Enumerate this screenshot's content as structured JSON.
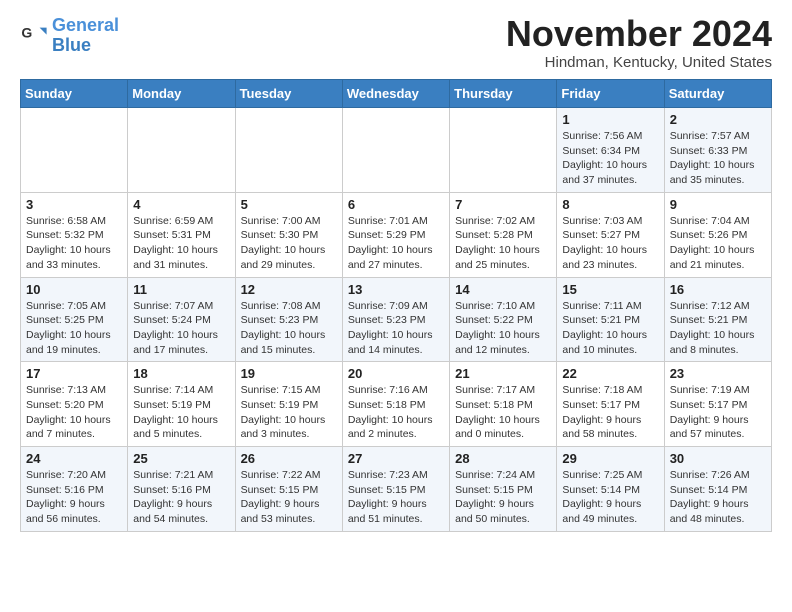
{
  "logo": {
    "line1": "General",
    "line2": "Blue"
  },
  "title": "November 2024",
  "location": "Hindman, Kentucky, United States",
  "weekdays": [
    "Sunday",
    "Monday",
    "Tuesday",
    "Wednesday",
    "Thursday",
    "Friday",
    "Saturday"
  ],
  "weeks": [
    [
      {
        "day": "",
        "info": ""
      },
      {
        "day": "",
        "info": ""
      },
      {
        "day": "",
        "info": ""
      },
      {
        "day": "",
        "info": ""
      },
      {
        "day": "",
        "info": ""
      },
      {
        "day": "1",
        "info": "Sunrise: 7:56 AM\nSunset: 6:34 PM\nDaylight: 10 hours and 37 minutes."
      },
      {
        "day": "2",
        "info": "Sunrise: 7:57 AM\nSunset: 6:33 PM\nDaylight: 10 hours and 35 minutes."
      }
    ],
    [
      {
        "day": "3",
        "info": "Sunrise: 6:58 AM\nSunset: 5:32 PM\nDaylight: 10 hours and 33 minutes."
      },
      {
        "day": "4",
        "info": "Sunrise: 6:59 AM\nSunset: 5:31 PM\nDaylight: 10 hours and 31 minutes."
      },
      {
        "day": "5",
        "info": "Sunrise: 7:00 AM\nSunset: 5:30 PM\nDaylight: 10 hours and 29 minutes."
      },
      {
        "day": "6",
        "info": "Sunrise: 7:01 AM\nSunset: 5:29 PM\nDaylight: 10 hours and 27 minutes."
      },
      {
        "day": "7",
        "info": "Sunrise: 7:02 AM\nSunset: 5:28 PM\nDaylight: 10 hours and 25 minutes."
      },
      {
        "day": "8",
        "info": "Sunrise: 7:03 AM\nSunset: 5:27 PM\nDaylight: 10 hours and 23 minutes."
      },
      {
        "day": "9",
        "info": "Sunrise: 7:04 AM\nSunset: 5:26 PM\nDaylight: 10 hours and 21 minutes."
      }
    ],
    [
      {
        "day": "10",
        "info": "Sunrise: 7:05 AM\nSunset: 5:25 PM\nDaylight: 10 hours and 19 minutes."
      },
      {
        "day": "11",
        "info": "Sunrise: 7:07 AM\nSunset: 5:24 PM\nDaylight: 10 hours and 17 minutes."
      },
      {
        "day": "12",
        "info": "Sunrise: 7:08 AM\nSunset: 5:23 PM\nDaylight: 10 hours and 15 minutes."
      },
      {
        "day": "13",
        "info": "Sunrise: 7:09 AM\nSunset: 5:23 PM\nDaylight: 10 hours and 14 minutes."
      },
      {
        "day": "14",
        "info": "Sunrise: 7:10 AM\nSunset: 5:22 PM\nDaylight: 10 hours and 12 minutes."
      },
      {
        "day": "15",
        "info": "Sunrise: 7:11 AM\nSunset: 5:21 PM\nDaylight: 10 hours and 10 minutes."
      },
      {
        "day": "16",
        "info": "Sunrise: 7:12 AM\nSunset: 5:21 PM\nDaylight: 10 hours and 8 minutes."
      }
    ],
    [
      {
        "day": "17",
        "info": "Sunrise: 7:13 AM\nSunset: 5:20 PM\nDaylight: 10 hours and 7 minutes."
      },
      {
        "day": "18",
        "info": "Sunrise: 7:14 AM\nSunset: 5:19 PM\nDaylight: 10 hours and 5 minutes."
      },
      {
        "day": "19",
        "info": "Sunrise: 7:15 AM\nSunset: 5:19 PM\nDaylight: 10 hours and 3 minutes."
      },
      {
        "day": "20",
        "info": "Sunrise: 7:16 AM\nSunset: 5:18 PM\nDaylight: 10 hours and 2 minutes."
      },
      {
        "day": "21",
        "info": "Sunrise: 7:17 AM\nSunset: 5:18 PM\nDaylight: 10 hours and 0 minutes."
      },
      {
        "day": "22",
        "info": "Sunrise: 7:18 AM\nSunset: 5:17 PM\nDaylight: 9 hours and 58 minutes."
      },
      {
        "day": "23",
        "info": "Sunrise: 7:19 AM\nSunset: 5:17 PM\nDaylight: 9 hours and 57 minutes."
      }
    ],
    [
      {
        "day": "24",
        "info": "Sunrise: 7:20 AM\nSunset: 5:16 PM\nDaylight: 9 hours and 56 minutes."
      },
      {
        "day": "25",
        "info": "Sunrise: 7:21 AM\nSunset: 5:16 PM\nDaylight: 9 hours and 54 minutes."
      },
      {
        "day": "26",
        "info": "Sunrise: 7:22 AM\nSunset: 5:15 PM\nDaylight: 9 hours and 53 minutes."
      },
      {
        "day": "27",
        "info": "Sunrise: 7:23 AM\nSunset: 5:15 PM\nDaylight: 9 hours and 51 minutes."
      },
      {
        "day": "28",
        "info": "Sunrise: 7:24 AM\nSunset: 5:15 PM\nDaylight: 9 hours and 50 minutes."
      },
      {
        "day": "29",
        "info": "Sunrise: 7:25 AM\nSunset: 5:14 PM\nDaylight: 9 hours and 49 minutes."
      },
      {
        "day": "30",
        "info": "Sunrise: 7:26 AM\nSunset: 5:14 PM\nDaylight: 9 hours and 48 minutes."
      }
    ]
  ]
}
